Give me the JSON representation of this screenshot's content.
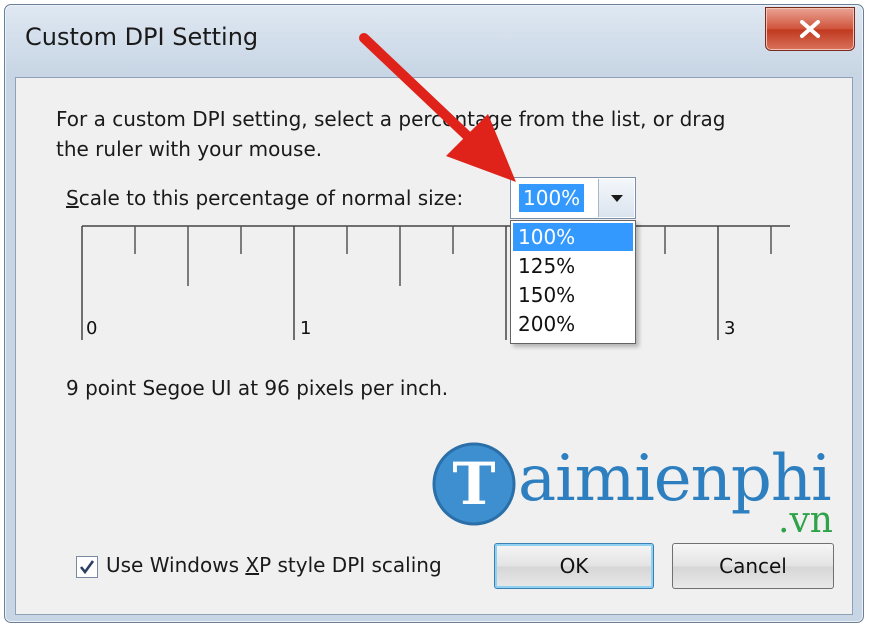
{
  "window": {
    "title": "Custom DPI Setting",
    "close_label": "X"
  },
  "description": "For a custom DPI setting, select a percentage from the list, or drag the ruler with your mouse.",
  "scale": {
    "label_u": "S",
    "label_rest": "cale to this percentage of normal size:",
    "selected": "100%",
    "options": [
      "100%",
      "125%",
      "150%",
      "200%"
    ]
  },
  "ruler": {
    "labels": [
      "0",
      "1",
      "3"
    ]
  },
  "font_info": "9 point Segoe UI at 96 pixels per inch.",
  "watermark": {
    "brand": "aimienphi",
    "tld": ".vn",
    "mark": "T"
  },
  "xp_scaling": {
    "checked": true,
    "label_before": "Use Windows ",
    "label_u": "X",
    "label_after": "P style DPI scaling"
  },
  "buttons": {
    "ok": "OK",
    "cancel": "Cancel"
  },
  "colors": {
    "selection": "#3399ff",
    "annotation_arrow": "#e0231a"
  }
}
